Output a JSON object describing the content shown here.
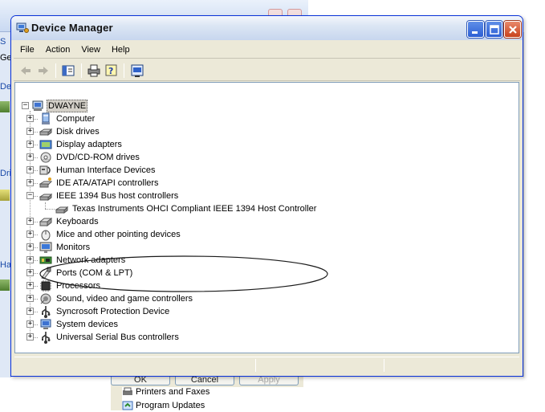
{
  "background": {
    "left_fragments": [
      "S",
      "Ge",
      "Dev",
      "Driv",
      "Har"
    ],
    "buttons": [
      "OK",
      "Cancel",
      "Apply"
    ],
    "list_items": [
      "Printers and Faxes",
      "Program Updates"
    ]
  },
  "window": {
    "title": "Device Manager",
    "controls": {
      "minimize": "minimize",
      "maximize": "maximize",
      "close": "close"
    }
  },
  "menu": [
    "File",
    "Action",
    "View",
    "Help"
  ],
  "toolbar": [
    "back-icon",
    "forward-icon",
    "show-hide-tree-icon",
    "print-icon",
    "help-icon",
    "properties-icon"
  ],
  "tree": {
    "root": "DWAYNE",
    "categories": [
      {
        "label": "Computer",
        "icon": "computer-icon",
        "expanded": false
      },
      {
        "label": "Disk drives",
        "icon": "disk-drive-icon",
        "expanded": false
      },
      {
        "label": "Display adapters",
        "icon": "display-adapter-icon",
        "expanded": false
      },
      {
        "label": "DVD/CD-ROM drives",
        "icon": "cdrom-icon",
        "expanded": false
      },
      {
        "label": "Human Interface Devices",
        "icon": "hid-icon",
        "expanded": false
      },
      {
        "label": "IDE ATA/ATAPI controllers",
        "icon": "ide-controller-icon",
        "expanded": false
      },
      {
        "label": "IEEE 1394 Bus host controllers",
        "icon": "ieee1394-icon",
        "expanded": true,
        "children": [
          "Texas Instruments OHCI Compliant IEEE 1394 Host Controller"
        ]
      },
      {
        "label": "Keyboards",
        "icon": "keyboard-icon",
        "expanded": false
      },
      {
        "label": "Mice and other pointing devices",
        "icon": "mouse-icon",
        "expanded": false
      },
      {
        "label": "Monitors",
        "icon": "monitor-icon",
        "expanded": false
      },
      {
        "label": "Network adapters",
        "icon": "network-adapter-icon",
        "expanded": false
      },
      {
        "label": "Ports (COM & LPT)",
        "icon": "port-icon",
        "expanded": false
      },
      {
        "label": "Processors",
        "icon": "processor-icon",
        "expanded": false
      },
      {
        "label": "Sound, video and game controllers",
        "icon": "sound-icon",
        "expanded": false
      },
      {
        "label": "Syncrosoft Protection Device",
        "icon": "usb-icon",
        "expanded": false
      },
      {
        "label": "System devices",
        "icon": "system-device-icon",
        "expanded": false
      },
      {
        "label": "Universal Serial Bus controllers",
        "icon": "usb-icon",
        "expanded": false
      }
    ]
  },
  "colors": {
    "titlebar_border": "#0831d9",
    "close_button": "#c8421d",
    "window_face": "#ece9d8",
    "highlight_ellipse": "#1a1a1a"
  }
}
